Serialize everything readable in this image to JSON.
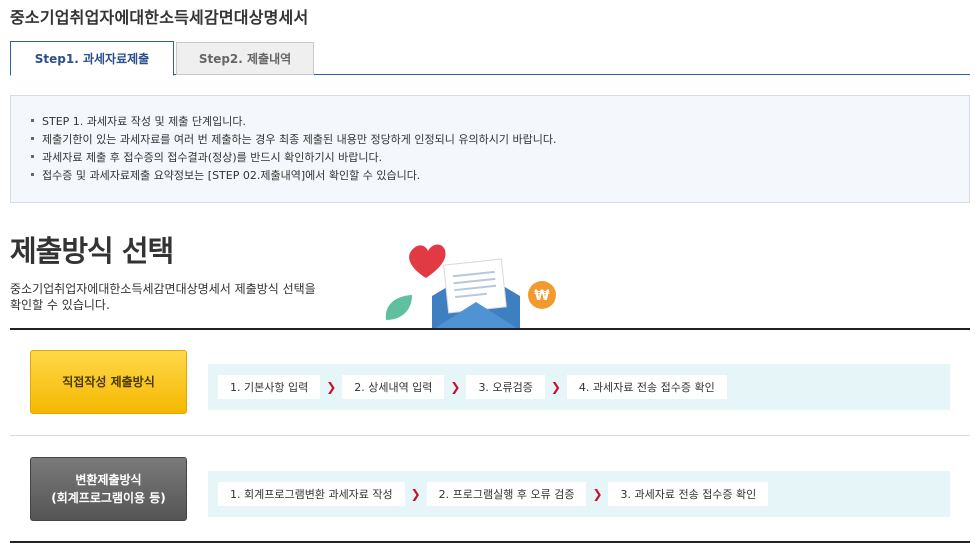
{
  "page": {
    "title": "중소기업취업자에대한소득세감면대상명세서"
  },
  "tabs": [
    {
      "label": "Step1. 과세자료제출",
      "active": true
    },
    {
      "label": "Step2. 제출내역",
      "active": false
    }
  ],
  "notice": {
    "items": [
      "STEP 1. 과세자료 작성 및 제출 단계입니다.",
      "제출기한이 있는 과세자료를 여러 번 제출하는 경우 최종 제출된 내용만 정당하게 인정되니 유의하시기 바랍니다.",
      "과세자료 제출 후 접수증의 접수결과(정상)를 반드시 확인하기시 바랍니다.",
      "접수증 및 과세자료제출 요약정보는 [STEP 02.제출내역]에서 확인할 수 있습니다."
    ]
  },
  "section": {
    "title": "제출방식 선택",
    "desc_line1": "중소기업취업자에대한소득세감면대상명세서 제출방식 선택을",
    "desc_line2": "확인할 수 있습니다."
  },
  "methods": {
    "direct": {
      "label": "직접작성 제출방식",
      "steps": [
        "1. 기본사항 입력",
        "2. 상세내역 입력",
        "3. 오류검증",
        "4. 과세자료 전송 접수증 확인"
      ]
    },
    "convert": {
      "label_line1": "변환제출방식",
      "label_line2": "(회계프로그램이용 등)",
      "steps": [
        "1. 회계프로그램변환 과세자료 작성",
        "2. 프로그램실행 후 오류 검증",
        "3. 과세자료 전송 접수증 확인"
      ]
    }
  },
  "colors": {
    "accent_blue": "#2f5ea8",
    "yellow_button": "#f5b800",
    "gray_button": "#555555",
    "step_bg": "#e6f5f7",
    "arrow_red": "#c8102e"
  },
  "icons": [
    "heart-icon",
    "envelope-icon",
    "won-coin-icon",
    "leaf-icon",
    "step-arrow-icon"
  ]
}
